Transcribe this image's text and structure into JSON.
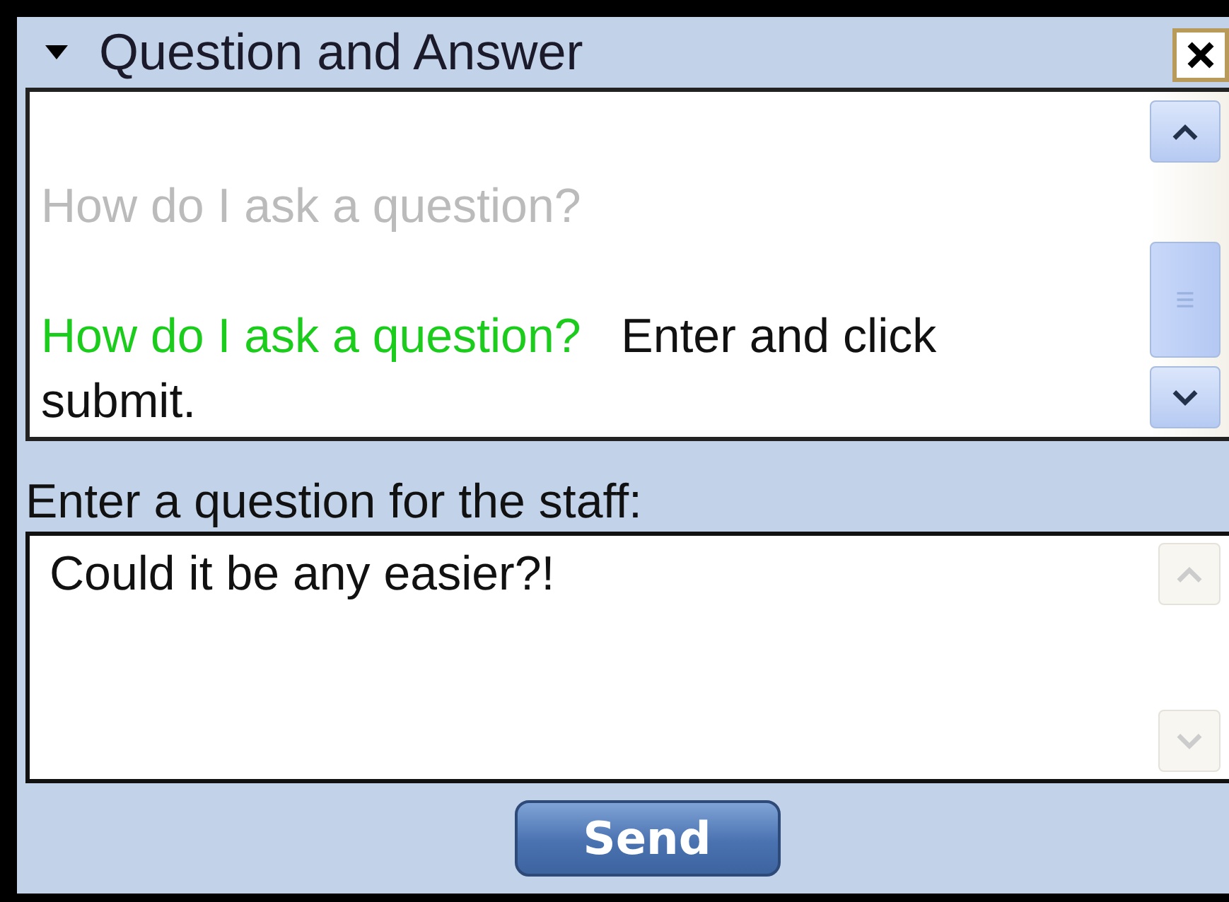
{
  "panel": {
    "title": "Question and Answer",
    "expanded": true
  },
  "messages": [
    {
      "question": "How do I ask a question?",
      "answered": false
    },
    {
      "question": "How do I ask a question?",
      "answered": true,
      "answer": "Enter and click submit."
    }
  ],
  "question_form": {
    "label": "Enter a question for the staff:",
    "value": "Could it be any easier?!"
  },
  "send_button": "Send"
}
